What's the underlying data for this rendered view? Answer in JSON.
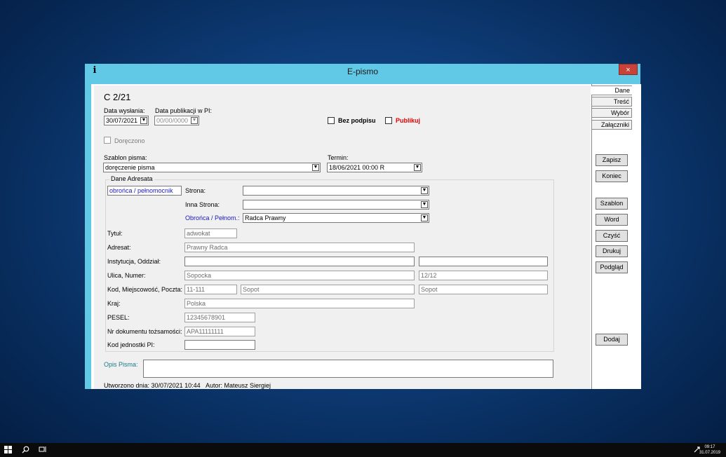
{
  "window": {
    "title": "E-pismo",
    "close_label": "×",
    "app_icon_glyph": "i"
  },
  "header": {
    "case_no": "C 2/21",
    "send_date_label": "Data wysłania:",
    "send_date_value": "30/07/2021",
    "pub_date_label": "Data publikacji w PI:",
    "pub_date_value": "00/00/0000",
    "no_signature_label": "Bez podpisu",
    "publish_label": "Publikuj",
    "delivered_label": "Doręczono",
    "template_label": "Szablon pisma:",
    "template_value": "doręczenie pisma",
    "deadline_label": "Termin:",
    "deadline_value": "18/06/2021  00:00  R"
  },
  "addressee": {
    "group_label": "Dane Adresata",
    "role_value": "obrońca / pełnomocnik",
    "strona_label": "Strona:",
    "strona_value": "",
    "inna_strona_label": "Inna Strona:",
    "inna_strona_value": "",
    "obronca_label": "Obrońca / Pełnom.:",
    "obronca_value": "Radca Prawny",
    "tytul_label": "Tytuł:",
    "tytul_value": "adwokat",
    "adresat_label": "Adresat:",
    "adresat_value": "Prawny Radca",
    "instytucja_label": "Instytucja, Oddział:",
    "instytucja_value": "",
    "instytucja_value2": "",
    "ulica_label": "Ulica, Numer:",
    "ulica_value": "Sopocka",
    "numer_value": "12/12",
    "kod_label": "Kod, Miejscowość, Poczta:",
    "kod_value": "11-111",
    "miejscowosc_value": "Sopot",
    "poczta_value": "Sopot",
    "kraj_label": "Kraj:",
    "kraj_value": "Polska",
    "pesel_label": "PESEL:",
    "pesel_value": "12345678901",
    "doc_label": "Nr dokumentu tożsamości:",
    "doc_value": "APA11111111",
    "kod_pi_label": "Kod jednostki PI:",
    "kod_pi_value": ""
  },
  "description": {
    "label": "Opis Pisma:",
    "value": ""
  },
  "footer": {
    "created_text": "Utworzono dnia:  30/07/2021 10:44",
    "author_text": "Autor: Mateusz Siergiej"
  },
  "tabs": [
    "Dane",
    "Treść",
    "Wybór",
    "Załączniki"
  ],
  "buttons": {
    "save": "Zapisz",
    "end": "Koniec",
    "template": "Szablon",
    "word": "Word",
    "clear": "Czyść",
    "print": "Drukuj",
    "preview": "Podgląd",
    "add": "Dodaj"
  },
  "taskbar": {
    "start_icon": "windows-start-icon",
    "search_icon": "search-icon",
    "taskview_icon": "task-view-icon",
    "tray_icon": "network-icon",
    "time": "09:17",
    "date": "31.07.2019"
  },
  "colors": {
    "window_frame": "#61c8e6",
    "close_button": "#c8423a",
    "publish_red": "#e00000",
    "label_blue": "#1818b8",
    "desc_label": "#1a7a8a"
  }
}
